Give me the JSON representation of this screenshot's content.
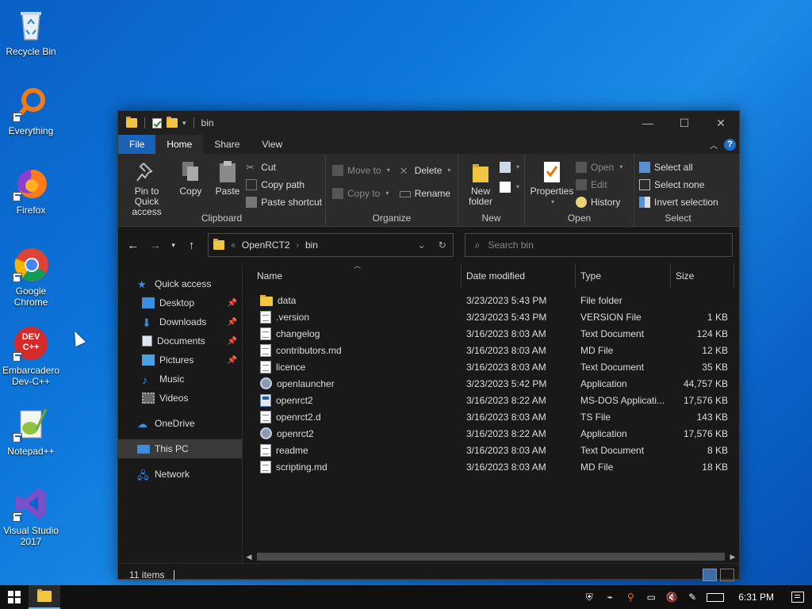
{
  "desktop": {
    "icons": [
      {
        "label": "Recycle Bin",
        "icon": "recycle-bin-icon"
      },
      {
        "label": "Everything",
        "icon": "everything-search-icon"
      },
      {
        "label": "Firefox",
        "icon": "firefox-icon"
      },
      {
        "label": "Google Chrome",
        "icon": "chrome-icon"
      },
      {
        "label": "Embarcadero Dev-C++",
        "icon": "devcpp-icon"
      },
      {
        "label": "Notepad++",
        "icon": "notepadpp-icon"
      },
      {
        "label": "Visual Studio 2017",
        "icon": "visual-studio-icon"
      }
    ],
    "devcpp_badge": "DEV C++"
  },
  "window": {
    "title": "bin",
    "controls": {
      "minimize": "—",
      "maximize": "☐",
      "close": "✕"
    }
  },
  "tabs": [
    {
      "label": "File"
    },
    {
      "label": "Home"
    },
    {
      "label": "Share"
    },
    {
      "label": "View"
    }
  ],
  "ribbon": {
    "clipboard": {
      "label": "Clipboard",
      "pin": "Pin to Quick access",
      "copy": "Copy",
      "paste": "Paste",
      "cut": "Cut",
      "copy_path": "Copy path",
      "paste_shortcut": "Paste shortcut"
    },
    "organize": {
      "label": "Organize",
      "move_to": "Move to",
      "copy_to": "Copy to",
      "delete": "Delete",
      "rename": "Rename"
    },
    "new": {
      "label": "New",
      "new_folder": "New folder"
    },
    "open": {
      "label": "Open",
      "properties": "Properties",
      "open": "Open",
      "edit": "Edit",
      "history": "History"
    },
    "select": {
      "label": "Select",
      "select_all": "Select all",
      "select_none": "Select none",
      "invert_selection": "Invert selection"
    }
  },
  "address": {
    "crumbs": [
      "OpenRCT2",
      "bin"
    ],
    "search_placeholder": "Search bin"
  },
  "navpane": {
    "quick_access": "Quick access",
    "quick_items": [
      {
        "label": "Desktop",
        "pinned": true
      },
      {
        "label": "Downloads",
        "pinned": true
      },
      {
        "label": "Documents",
        "pinned": true
      },
      {
        "label": "Pictures",
        "pinned": true
      },
      {
        "label": "Music",
        "pinned": false
      },
      {
        "label": "Videos",
        "pinned": false
      }
    ],
    "onedrive": "OneDrive",
    "this_pc": "This PC",
    "network": "Network"
  },
  "columns": {
    "name": "Name",
    "date": "Date modified",
    "type": "Type",
    "size": "Size"
  },
  "files": [
    {
      "name": "data",
      "date": "3/23/2023 5:43 PM",
      "type": "File folder",
      "size": "",
      "kind": "folder"
    },
    {
      "name": ".version",
      "date": "3/23/2023 5:43 PM",
      "type": "VERSION File",
      "size": "1 KB",
      "kind": "doc"
    },
    {
      "name": "changelog",
      "date": "3/16/2023 8:03 AM",
      "type": "Text Document",
      "size": "124 KB",
      "kind": "doc"
    },
    {
      "name": "contributors.md",
      "date": "3/16/2023 8:03 AM",
      "type": "MD File",
      "size": "12 KB",
      "kind": "doc"
    },
    {
      "name": "licence",
      "date": "3/16/2023 8:03 AM",
      "type": "Text Document",
      "size": "35 KB",
      "kind": "doc"
    },
    {
      "name": "openlauncher",
      "date": "3/23/2023 5:42 PM",
      "type": "Application",
      "size": "44,757 KB",
      "kind": "app"
    },
    {
      "name": "openrct2",
      "date": "3/16/2023 8:22 AM",
      "type": "MS-DOS Applicati...",
      "size": "17,576 KB",
      "kind": "dos"
    },
    {
      "name": "openrct2.d",
      "date": "3/16/2023 8:03 AM",
      "type": "TS File",
      "size": "143 KB",
      "kind": "doc"
    },
    {
      "name": "openrct2",
      "date": "3/16/2023 8:22 AM",
      "type": "Application",
      "size": "17,576 KB",
      "kind": "app"
    },
    {
      "name": "readme",
      "date": "3/16/2023 8:03 AM",
      "type": "Text Document",
      "size": "8 KB",
      "kind": "doc"
    },
    {
      "name": "scripting.md",
      "date": "3/16/2023 8:03 AM",
      "type": "MD File",
      "size": "18 KB",
      "kind": "doc"
    }
  ],
  "status": {
    "items": "11 items"
  },
  "taskbar": {
    "clock": "6:31 PM"
  }
}
